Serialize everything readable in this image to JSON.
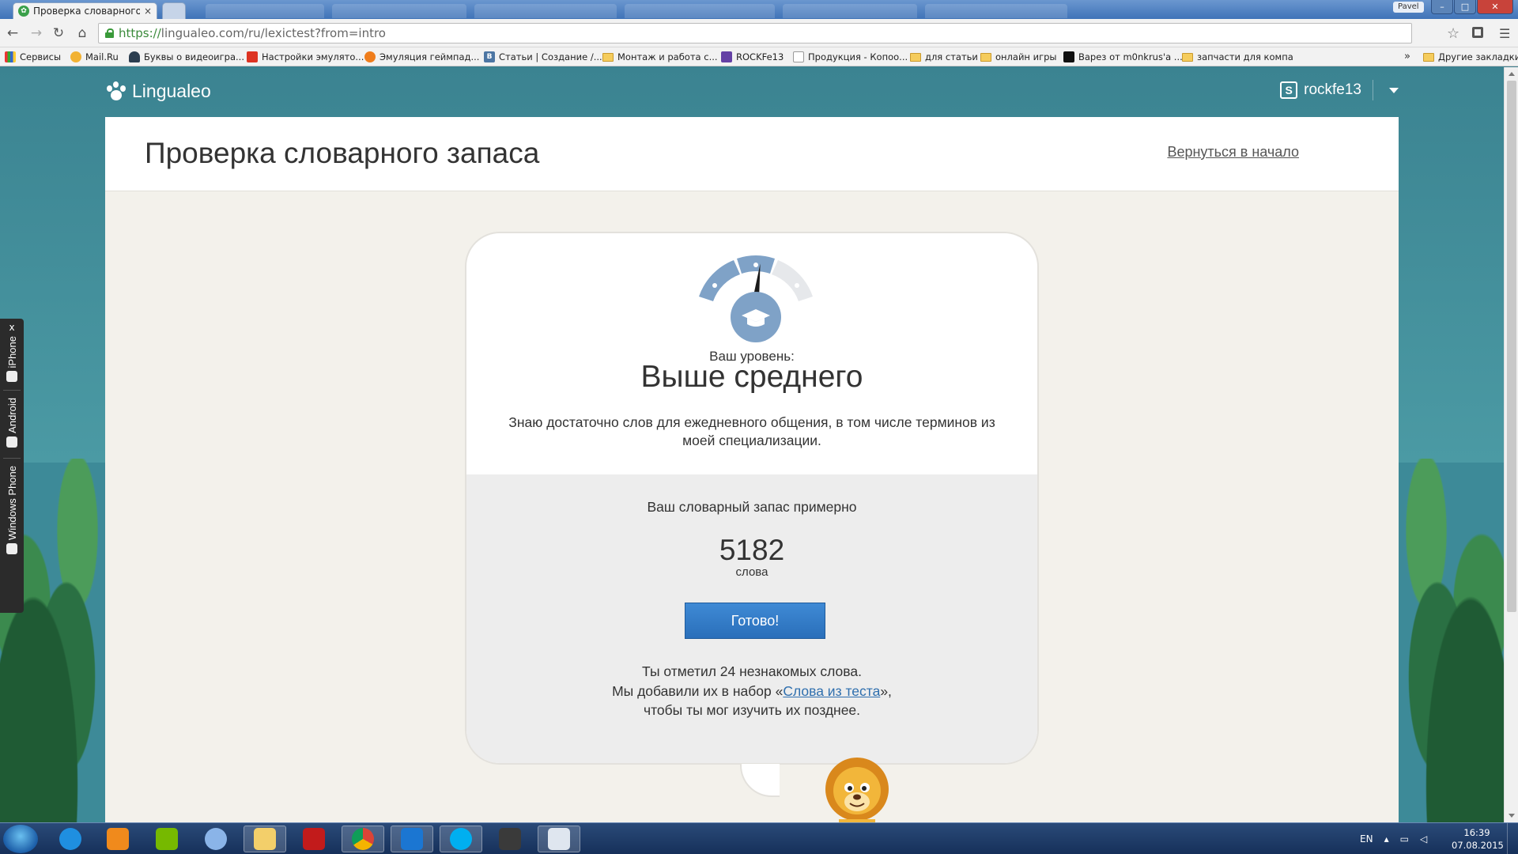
{
  "browser": {
    "tab_title": "Проверка словарного за",
    "tab_close": "×",
    "window_user": "Pavel",
    "window_controls": {
      "minimize": "–",
      "maximize": "□",
      "close": "✕"
    },
    "url_scheme": "https://",
    "url_rest": "lingualeo.com/ru/lexictest?from=intro"
  },
  "bookmarks": {
    "items": [
      {
        "label": "Сервисы",
        "icon": "apps-icon"
      },
      {
        "label": "Mail.Ru",
        "icon": "mailru-icon"
      },
      {
        "label": "Буквы о видеоигра...",
        "icon": "user-icon"
      },
      {
        "label": "Настройки эмулято...",
        "icon": "red-square-icon"
      },
      {
        "label": "Эмуляция геймпад...",
        "icon": "orange-circle-icon"
      },
      {
        "label": "Статьи | Создание /...",
        "icon": "vk-icon"
      },
      {
        "label": "Монтаж и работа с...",
        "icon": "folder-icon"
      },
      {
        "label": "ROCKFe13",
        "icon": "twitch-icon"
      },
      {
        "label": "Продукция - Копоо...",
        "icon": "page-icon"
      },
      {
        "label": "для статьи",
        "icon": "folder-icon"
      },
      {
        "label": "онлайн игры",
        "icon": "folder-icon"
      },
      {
        "label": "Варез от m0nkrus'а ...",
        "icon": "m-icon"
      },
      {
        "label": "запчасти для компа",
        "icon": "folder-icon"
      }
    ],
    "more": "»",
    "other": "Другие закладки"
  },
  "site": {
    "logo_text": "Lingualeo",
    "username": "rockfe13"
  },
  "page": {
    "title": "Проверка словарного запаса",
    "back_link": "Вернуться в начало"
  },
  "result": {
    "level_caption": "Ваш уровень:",
    "level_value": "Выше среднего",
    "level_description": "Знаю достаточно слов для ежедневного общения, в том числе терминов из моей специализации.",
    "gauge_level": 0.55,
    "vocab_caption": "Ваш словарный запас примерно",
    "vocab_count": "5182",
    "vocab_unit": "слова",
    "done_button": "Готово!",
    "note_line1": "Ты отметил 24 незнакомых слова.",
    "note_line2_prefix": "Мы добавили их в набор «",
    "note_link": "Слова из теста",
    "note_line2_suffix": "»,",
    "note_line3": "чтобы ты мог изучить их позднее."
  },
  "side_panel": {
    "close": "x",
    "items": [
      "iPhone",
      "Android",
      "Windows Phone"
    ]
  },
  "taskbar": {
    "language": "EN",
    "time": "16:39",
    "date": "07.08.2015"
  },
  "colors": {
    "brand_teal": "#3d8a98",
    "button_blue": "#2f7cc6",
    "gauge_blue": "#7fa2c7"
  }
}
